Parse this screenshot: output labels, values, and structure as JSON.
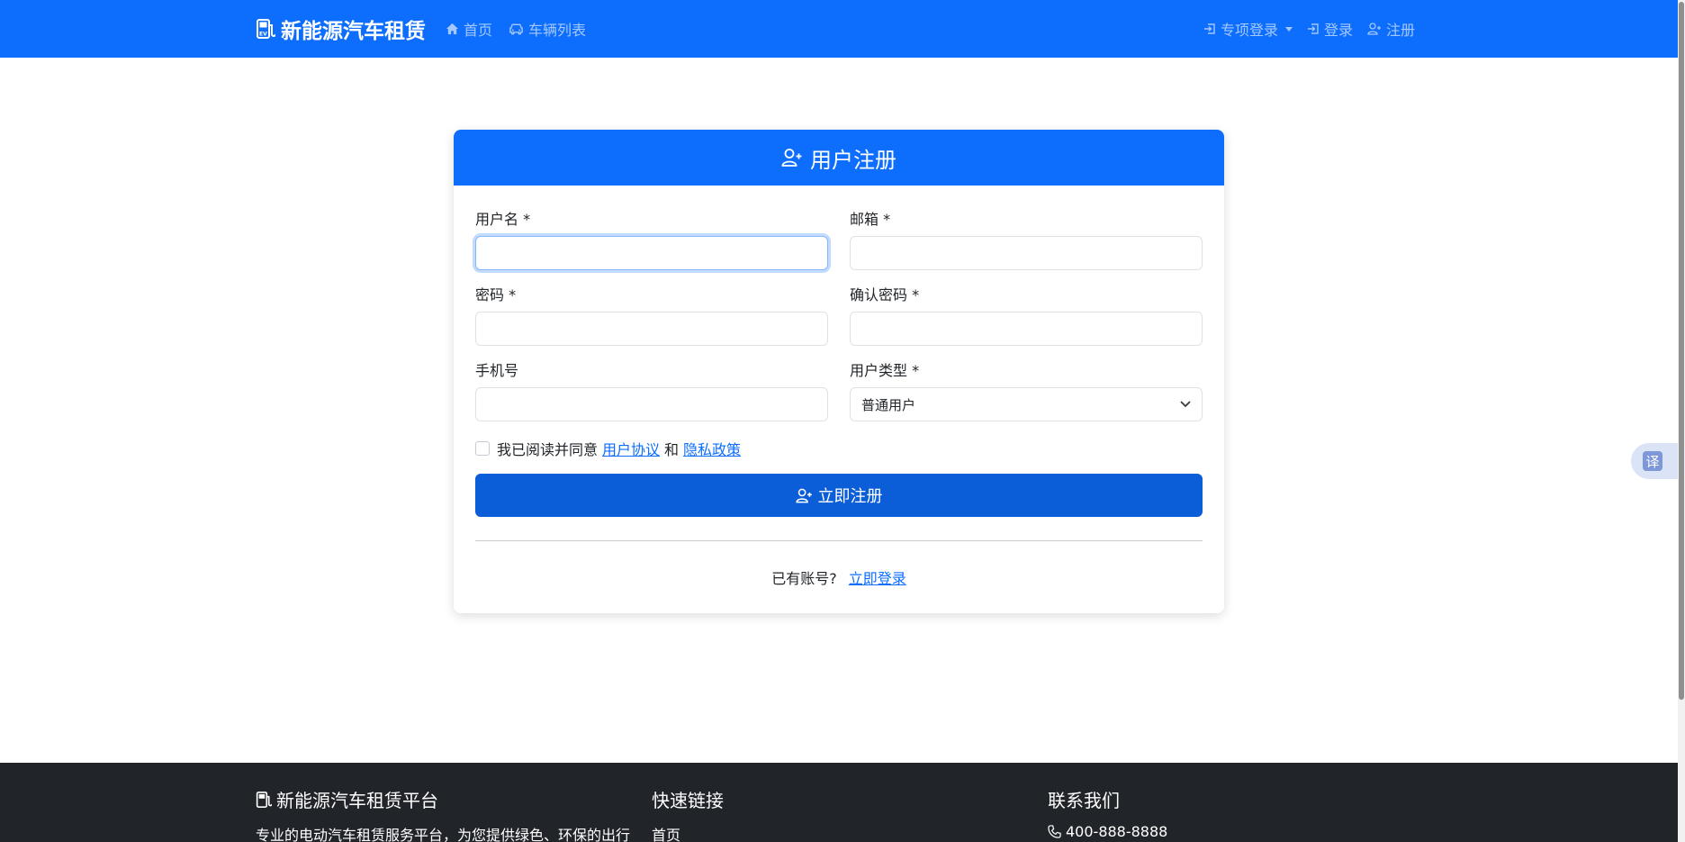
{
  "navbar": {
    "brand": "新能源汽车租赁",
    "home": "首页",
    "vehicles": "车辆列表",
    "special_login": "专项登录",
    "login": "登录",
    "register": "注册"
  },
  "card": {
    "title": "用户注册",
    "fields": {
      "username_label": "用户名 *",
      "email_label": "邮箱 *",
      "password_label": "密码 *",
      "confirm_label": "确认密码 *",
      "phone_label": "手机号",
      "usertype_label": "用户类型 *",
      "usertype_value": "普通用户"
    },
    "agree": {
      "prefix": "我已阅读并同意",
      "terms": "用户协议",
      "and": "和",
      "privacy": "隐私政策"
    },
    "submit": "立即注册",
    "have_account": "已有账号?",
    "login_now": "立即登录"
  },
  "translate": {
    "label": "译"
  },
  "footer": {
    "platform_title": "新能源汽车租赁平台",
    "platform_desc": "专业的电动汽车租赁服务平台，为您提供绿色、环保的出行",
    "links_title": "快速链接",
    "links_home": "首页",
    "contact_title": "联系我们",
    "contact_phone": "400-888-8888"
  },
  "colors": {
    "primary": "#0d6efd",
    "footer_bg": "#212529"
  }
}
